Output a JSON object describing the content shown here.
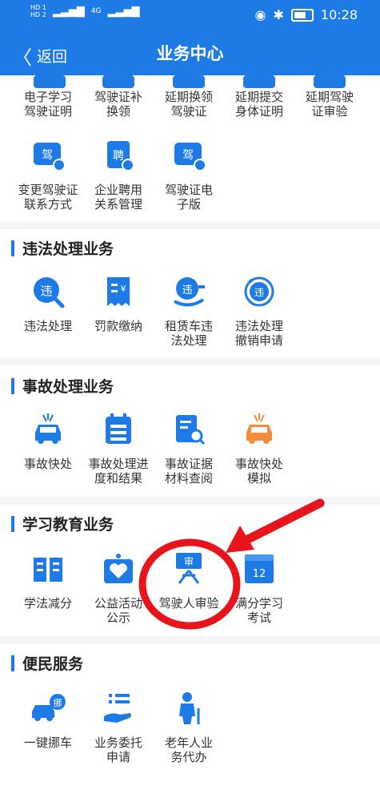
{
  "status": {
    "signal_left": "HD 1\nHD 2",
    "net": "4G",
    "time": "10:28"
  },
  "nav": {
    "back_label": "返回",
    "title": "业务中心"
  },
  "top_items": [
    {
      "label": "电子学习\n驾驶证明",
      "icon": "license-study-icon"
    },
    {
      "label": "驾驶证补\n换领",
      "icon": "license-replace-icon"
    },
    {
      "label": "延期换领\n驾驶证",
      "icon": "license-extend-icon"
    },
    {
      "label": "延期提交\n身体证明",
      "icon": "health-proof-icon"
    },
    {
      "label": "延期驾驶\n证审验",
      "icon": "license-review-icon"
    },
    {
      "label": "变更驾驶证\n联系方式",
      "icon": "contact-change-icon"
    },
    {
      "label": "企业聘用\n关系管理",
      "icon": "employ-icon"
    },
    {
      "label": "驾驶证电\n子版",
      "icon": "e-license-icon"
    }
  ],
  "sections": [
    {
      "title": "违法处理业务",
      "items": [
        {
          "label": "违法处理",
          "icon": "violation-search-icon"
        },
        {
          "label": "罚款缴纳",
          "icon": "fine-pay-icon"
        },
        {
          "label": "租赁车违\n法处理",
          "icon": "rental-violation-icon"
        },
        {
          "label": "违法处理\n撤销申请",
          "icon": "violation-revoke-icon"
        }
      ]
    },
    {
      "title": "事故处理业务",
      "items": [
        {
          "label": "事故快处",
          "icon": "accident-quick-icon"
        },
        {
          "label": "事故处理进\n度和结果",
          "icon": "accident-progress-icon"
        },
        {
          "label": "事故证据\n材料查阅",
          "icon": "evidence-search-icon"
        },
        {
          "label": "事故快处\n模拟",
          "icon": "accident-simulate-icon"
        }
      ]
    },
    {
      "title": "学习教育业务",
      "items": [
        {
          "label": "学法减分",
          "icon": "study-book-icon"
        },
        {
          "label": "公益活动\n公示",
          "icon": "charity-icon"
        },
        {
          "label": "驾驶人审验",
          "icon": "driver-review-icon"
        },
        {
          "label": "满分学习\n考试",
          "icon": "full-score-exam-icon"
        }
      ]
    },
    {
      "title": "便民服务",
      "items": [
        {
          "label": "一键挪车",
          "icon": "move-car-icon"
        },
        {
          "label": "业务委托\n申请",
          "icon": "entrust-icon"
        },
        {
          "label": "老年人业\n务代办",
          "icon": "elderly-icon"
        }
      ]
    }
  ],
  "icon_glyphs": {
    "driving": "驾",
    "hire": "聘",
    "violation": "违",
    "review": "审",
    "exam": "12",
    "move": "挪"
  },
  "colors": {
    "primary": "#1e7be6",
    "orange": "#f58b3c",
    "annotation": "#e8141b"
  }
}
